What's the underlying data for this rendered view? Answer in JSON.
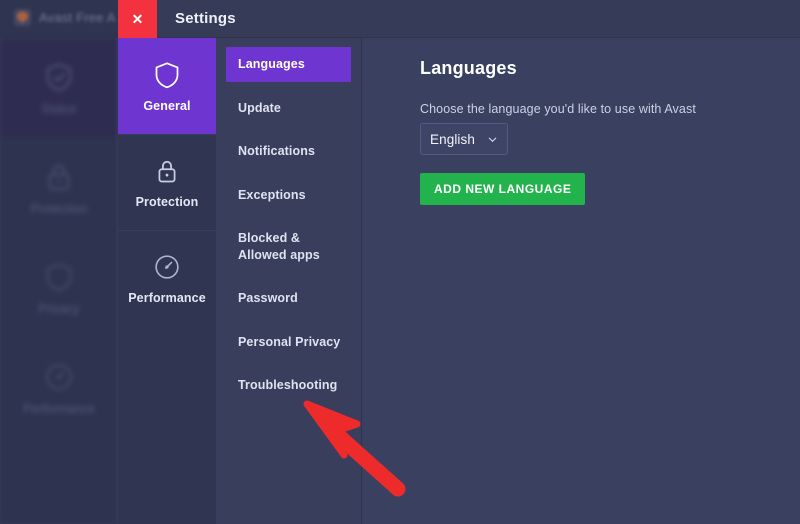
{
  "background_app": {
    "title": "Avast Free A",
    "logo_icon": "avast-logo-icon",
    "nav": [
      {
        "label": "Status",
        "icon": "shield-check-icon",
        "active": true
      },
      {
        "label": "Protection",
        "icon": "lock-icon",
        "active": false
      },
      {
        "label": "Privacy",
        "icon": "shield-icon",
        "active": false
      },
      {
        "label": "Performance",
        "icon": "speedometer-icon",
        "active": false
      }
    ]
  },
  "dialog": {
    "title": "Settings",
    "close_label": "✕",
    "close_icon": "close-icon",
    "categories": [
      {
        "label": "General",
        "icon": "shield-icon",
        "active": true
      },
      {
        "label": "Protection",
        "icon": "lock-icon",
        "active": false
      },
      {
        "label": "Performance",
        "icon": "speedometer-icon",
        "active": false
      }
    ],
    "menu": [
      {
        "label": "Languages",
        "active": true
      },
      {
        "label": "Update",
        "active": false
      },
      {
        "label": "Notifications",
        "active": false
      },
      {
        "label": "Exceptions",
        "active": false
      },
      {
        "label": "Blocked & Allowed apps",
        "active": false
      },
      {
        "label": "Password",
        "active": false
      },
      {
        "label": "Personal Privacy",
        "active": false
      },
      {
        "label": "Troubleshooting",
        "active": false
      }
    ],
    "panel": {
      "title": "Languages",
      "description": "Choose the language you'd like to use with Avast",
      "language_value": "English",
      "language_chevron_icon": "chevron-down-icon",
      "add_language_label": "ADD NEW LANGUAGE"
    }
  },
  "annotation": {
    "arrow_icon": "arrow-pointer-icon",
    "color": "#ee2b2b",
    "points_to": "Troubleshooting"
  },
  "colors": {
    "accent_purple": "#6f35d0",
    "green_button": "#23b34c",
    "close_red": "#f3313f",
    "panel_bg": "#3a4060",
    "rail_bg": "#303652",
    "annotation_red": "#ee2b2b"
  }
}
